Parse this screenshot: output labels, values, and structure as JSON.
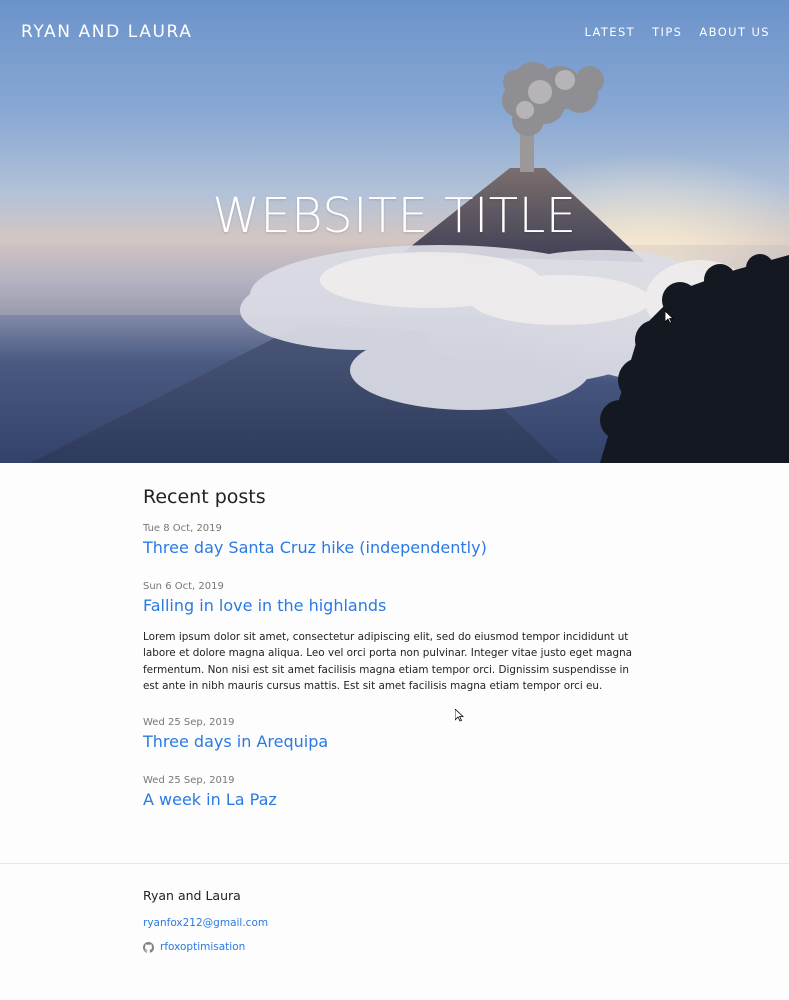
{
  "site": {
    "brand": "RYAN AND LAURA",
    "nav": [
      {
        "label": "LATEST"
      },
      {
        "label": "TIPS"
      },
      {
        "label": "ABOUT US"
      }
    ],
    "hero_title": "WEBSITE TITLE"
  },
  "main": {
    "heading": "Recent posts",
    "posts": [
      {
        "date": "Tue 8 Oct, 2019",
        "title": "Three day Santa Cruz hike (independently)"
      },
      {
        "date": "Sun 6 Oct, 2019",
        "title": "Falling in love in the highlands",
        "excerpt": "Lorem ipsum dolor sit amet, consectetur adipiscing elit, sed do eiusmod tempor incididunt ut labore et dolore magna aliqua. Leo vel orci porta non pulvinar. Integer vitae justo eget magna fermentum. Non nisi est sit amet facilisis magna etiam tempor orci. Dignissim suspendisse in est ante in nibh mauris cursus mattis. Est sit amet facilisis magna etiam tempor orci eu."
      },
      {
        "date": "Wed 25 Sep, 2019",
        "title": "Three days in Arequipa"
      },
      {
        "date": "Wed 25 Sep, 2019",
        "title": "A week in La Paz"
      }
    ]
  },
  "footer": {
    "name": "Ryan and Laura",
    "email": "ryanfox212@gmail.com",
    "github": "rfoxoptimisation",
    "github_icon": "github-icon"
  },
  "colors": {
    "link": "#2a7ae2",
    "text": "#222222",
    "date": "#777777",
    "background": "#fdfdfd"
  }
}
